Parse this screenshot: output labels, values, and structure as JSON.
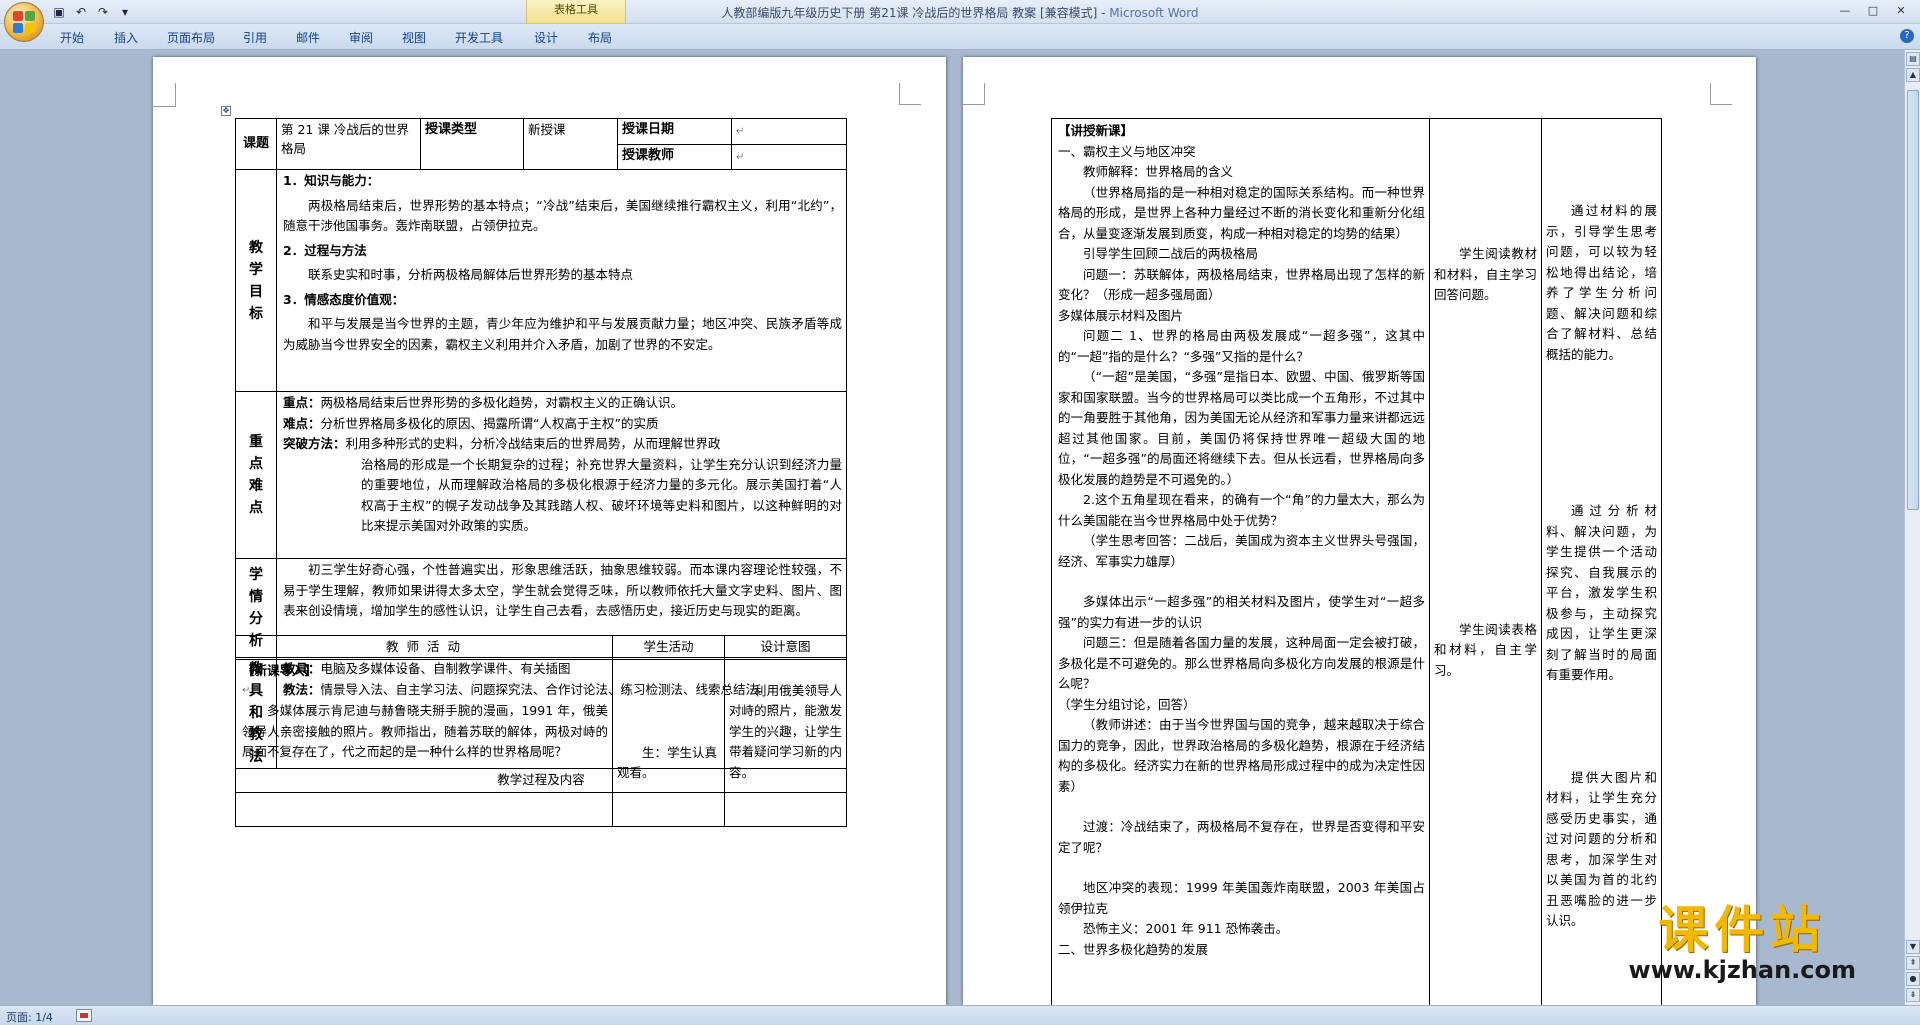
{
  "window": {
    "title": "人教部编版九年级历史下册 第21课 冷战后的世界格局 教案 [兼容模式] - ",
    "app": "Microsoft Word",
    "context_tab": "表格工具",
    "controls": [
      "—",
      "□",
      "✕"
    ]
  },
  "ribbon": {
    "tabs": [
      "开始",
      "插入",
      "页面布局",
      "引用",
      "邮件",
      "审阅",
      "视图",
      "开发工具",
      "设计",
      "布局"
    ]
  },
  "status": {
    "page": "页面: 1/4"
  },
  "watermark": {
    "text": "课件站",
    "url": "www.kjzhan.com"
  },
  "page1": {
    "header": {
      "keti_label": "课题",
      "keti_value": "第 21 课 冷战后的世界格局",
      "type_label": "授课类型",
      "type_value": "新授课",
      "date_label": "授课日期",
      "teacher_label": "授课教师"
    },
    "goals": {
      "label": "教学目标",
      "h1": "1．知识与能力：",
      "p1": "两极格局结束后，世界形势的基本特点；“冷战”结束后，美国继续推行霸权主义，利用“北约”，随意干涉他国事务。轰炸南联盟，占领伊拉克。",
      "h2": "2．过程与方法",
      "p2": "联系史实和时事，分析两极格局解体后世界形势的基本特点",
      "h3": "3．情感态度价值观：",
      "p3": "和平与发展是当今世界的主题，青少年应为维护和平与发展贡献力量；地区冲突、民族矛盾等成为威胁当今世界安全的因素，霸权主义利用并介入矛盾，加剧了世界的不安定。"
    },
    "keypoints": {
      "label": "重点难点",
      "zd_label": "重点：",
      "zd": "两极格局结束后世界形势的多极化趋势，对霸权主义的正确认识。",
      "nd_label": "难点：",
      "nd": "分析世界格局多极化的原因、揭露所谓“人权高于主权”的实质",
      "tp_label": "突破方法：",
      "tp": "利用多种形式的史料，分析冷战结束后的世界局势，从而理解世界政",
      "tp2": "治格局的形成是一个长期复杂的过程；补充世界大量资料，让学生充分认识到经济力量的重要地位，从而理解政治格局的多极化根源于经济力量的多元化。展示美国打着“人权高于主权”的幌子发动战争及其践踏人权、破坏环境等史料和图片，以这种鲜明的对比来提示美国对外政策的实质。"
    },
    "analysis": {
      "label": "学情分析",
      "text": "初三学生好奇心强，个性普遍实出，形象思维活跃，抽象思维较弱。而本课内容理论性较强，不易于学生理解，教师如果讲得太多太空，学生就会觉得乏味，所以教师依托大量文字史料、图片、图表来创设情境，增加学生的感性认识，让学生自己去看，去感悟历史，接近历史与现实的距离。"
    },
    "tools": {
      "label": "教具和教法",
      "tool_label": "教具：",
      "tool": "电脑及多媒体设备、自制教学课件、有关插图",
      "method_label": "教法：",
      "method": "情景导入法、自主学习法、问题探究法、合作讨论法、练习检测法、线索总结法。"
    },
    "process": {
      "title": "教学过程及内容",
      "col_teacher": "教 师 活 动",
      "col_student": "学生活动",
      "col_intent": "设计意图",
      "intro_title": "【新课导入】",
      "intro_text": "多媒体展示肯尼迪与赫鲁晓夫掰手腕的漫画，1991 年，俄美领导人亲密接触的照片。教师指出，随着苏联的解体，两极对峙的局面不复存在了，代之而起的是一种什么样的世界格局呢？",
      "intro_student": "生：学生认真观看。",
      "intro_intent": "利用俄美领导人对峙的照片，能激发学生的兴趣，让学生带着疑问学习新的内容。"
    }
  },
  "page2": {
    "teacher_col": [
      {
        "t": "【讲授新课】",
        "c": "b"
      },
      {
        "t": "一、霸权主义与地区冲突",
        "c": ""
      },
      {
        "t": "教师解释：世界格局的含义",
        "c": "ind"
      },
      {
        "t": "（世界格局指的是一种相对稳定的国际关系结构。而一种世界格局的形成，是世界上各种力量经过不断的消长变化和重新分化组合，从量变逐渐发展到质变，构成一种相对稳定的均势的结果）",
        "c": "ind"
      },
      {
        "t": "引导学生回顾二战后的两极格局",
        "c": "ind"
      },
      {
        "t": "问题一：苏联解体，两极格局结束，世界格局出现了怎样的新变化？（形成一超多强局面）",
        "c": "ind"
      },
      {
        "t": "多媒体展示材料及图片",
        "c": ""
      },
      {
        "t": "问题二 1、世界的格局由两极发展成“一超多强”，这其中的“一超”指的是什么？“多强”又指的是什么？",
        "c": "ind"
      },
      {
        "t": "（“一超”是美国，“多强”是指日本、欧盟、中国、俄罗斯等国家和国家联盟。当今的世界格局可以类比成一个五角形，不过其中的一角要胜于其他角，因为美国无论从经济和军事力量来讲都远远超过其他国家。目前，美国仍将保持世界唯一超级大国的地位，“一超多强”的局面还将继续下去。但从长远看，世界格局向多极化发展的趋势是不可遏免的。）",
        "c": "ind"
      },
      {
        "t": "2.这个五角星现在看来，的确有一个“角”的力量太大，那么为什么美国能在当今世界格局中处于优势？",
        "c": "ind"
      },
      {
        "t": "（学生思考回答：二战后，美国成为资本主义世界头号强国，经济、军事实力雄厚）",
        "c": "ind"
      },
      {
        "t": "",
        "c": ""
      },
      {
        "t": "多媒体出示“一超多强”的相关材料及图片，使学生对“一超多强”的实力有进一步的认识",
        "c": "ind"
      },
      {
        "t": "问题三：但是随着各国力量的发展，这种局面一定会被打破，多极化是不可避免的。那么世界格局向多极化方向发展的根源是什么呢？",
        "c": "ind"
      },
      {
        "t": "（学生分组讨论，回答）",
        "c": ""
      },
      {
        "t": "（教师讲述：由于当今世界国与国的竞争，越来越取决于综合国力的竞争，因此，世界政治格局的多极化趋势，根源在于经济结构的多极化。经济实力在新的世界格局形成过程中的成为决定性因素）",
        "c": "ind"
      },
      {
        "t": "",
        "c": ""
      },
      {
        "t": "过渡：冷战结束了，两极格局不复存在，世界是否变得和平安定了呢？",
        "c": "ind"
      },
      {
        "t": "",
        "c": ""
      },
      {
        "t": "地区冲突的表现：1999 年美国轰炸南联盟，2003 年美国占领伊拉克",
        "c": "ind"
      },
      {
        "t": "恐怖主义：2001 年 911 恐怖袭击。",
        "c": "ind"
      },
      {
        "t": "二、世界多极化趋势的发展",
        "c": ""
      }
    ],
    "student_col_1": "学生阅读教材和材料，自主学习回答问题。",
    "student_col_2": "学生阅读表格和材料，自主学习。",
    "intent_col_1": "通过材料的展示，引导学生思考问题，可以较为轻松地得出结论，培养了学生分析问题、解决问题和综合了解材料、总结概括的能力。",
    "intent_col_2": "通过分析材料、解决问题，为学生提供一个活动探究、自我展示的平台，激发学生积极参与，主动探究成因，让学生更深刻了解当时的局面有重要作用。",
    "intent_col_3": "提供大图片和材料，让学生充分感受历史事实，通过对问题的分析和思考，加深学生对以美国为首的北约丑恶嘴脸的进一步认识。"
  }
}
